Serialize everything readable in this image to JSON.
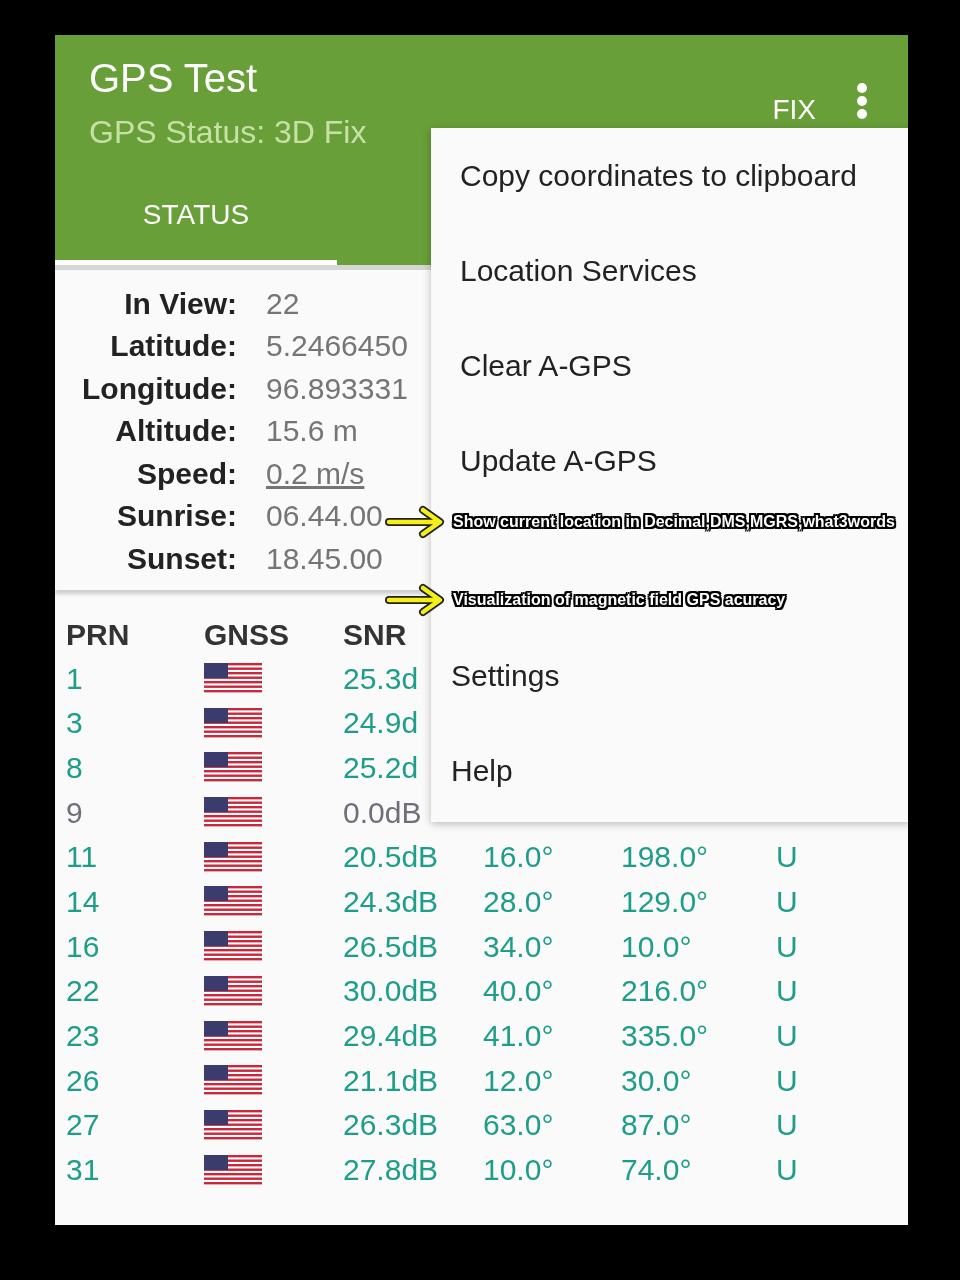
{
  "app_bar": {
    "title": "GPS Test",
    "subtitle": "GPS Status: 3D Fix",
    "action": "FIX"
  },
  "tabs": [
    {
      "label": "STATUS",
      "selected": true
    }
  ],
  "status": [
    {
      "label": "In View:",
      "value": "22",
      "link": false
    },
    {
      "label": "Latitude:",
      "value": "5.2466450",
      "link": false
    },
    {
      "label": "Longitude:",
      "value": "96.893331",
      "link": false
    },
    {
      "label": "Altitude:",
      "value": "15.6 m",
      "link": false
    },
    {
      "label": "Speed:",
      "value": "0.2 m/s",
      "link": true
    },
    {
      "label": "Sunrise:",
      "value": "06.44.00",
      "link": false
    },
    {
      "label": "Sunset:",
      "value": "18.45.00",
      "link": false
    }
  ],
  "table": {
    "columns": [
      "PRN",
      "GNSS",
      "SNR"
    ],
    "rows": [
      {
        "prn": "1",
        "snr": "25.3d",
        "used": true
      },
      {
        "prn": "3",
        "snr": "24.9d",
        "used": true
      },
      {
        "prn": "8",
        "snr": "25.2d",
        "used": true
      },
      {
        "prn": "9",
        "snr": "0.0dB",
        "used": false
      },
      {
        "prn": "11",
        "snr": "20.5dB",
        "elevation": "16.0°",
        "azimuth": "198.0°",
        "flags": "U",
        "used": true
      },
      {
        "prn": "14",
        "snr": "24.3dB",
        "elevation": "28.0°",
        "azimuth": "129.0°",
        "flags": "U",
        "used": true
      },
      {
        "prn": "16",
        "snr": "26.5dB",
        "elevation": "34.0°",
        "azimuth": "10.0°",
        "flags": "U",
        "used": true
      },
      {
        "prn": "22",
        "snr": "30.0dB",
        "elevation": "40.0°",
        "azimuth": "216.0°",
        "flags": "U",
        "used": true
      },
      {
        "prn": "23",
        "snr": "29.4dB",
        "elevation": "41.0°",
        "azimuth": "335.0°",
        "flags": "U",
        "used": true
      },
      {
        "prn": "26",
        "snr": "21.1dB",
        "elevation": "12.0°",
        "azimuth": "30.0°",
        "flags": "U",
        "used": true
      },
      {
        "prn": "27",
        "snr": "26.3dB",
        "elevation": "63.0°",
        "azimuth": "87.0°",
        "flags": "U",
        "used": true
      },
      {
        "prn": "31",
        "snr": "27.8dB",
        "elevation": "10.0°",
        "azimuth": "74.0°",
        "flags": "U",
        "used": true
      }
    ]
  },
  "menu": [
    "Copy coordinates to clipboard",
    "Location Services",
    "Clear A-GPS",
    "Update A-GPS",
    "Settings",
    "Help"
  ],
  "annotations": [
    "Show current location in Decimal,DMS,MGRS,what3words",
    "Visualization of magnetic field GPS acuracy"
  ]
}
